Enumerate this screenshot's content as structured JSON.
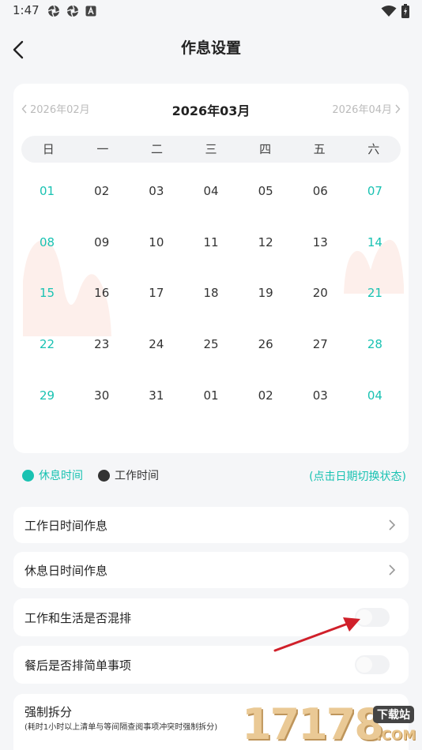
{
  "status_bar": {
    "time": "1:47",
    "icons": [
      "aperture-icon",
      "aperture-icon",
      "a-box-icon",
      "wifi-icon",
      "battery-charging-icon"
    ]
  },
  "header": {
    "back_icon": "chevron-left-icon",
    "title": "作息设置"
  },
  "calendar": {
    "prev_month": "2026年02月",
    "current_month": "2026年03月",
    "next_month": "2026年04月",
    "weekdays": [
      "日",
      "一",
      "二",
      "三",
      "四",
      "五",
      "六"
    ],
    "weeks": [
      [
        "01",
        "02",
        "03",
        "04",
        "05",
        "06",
        "07"
      ],
      [
        "08",
        "09",
        "10",
        "11",
        "12",
        "13",
        "14"
      ],
      [
        "15",
        "16",
        "17",
        "18",
        "19",
        "20",
        "21"
      ],
      [
        "22",
        "23",
        "24",
        "25",
        "26",
        "27",
        "28"
      ],
      [
        "29",
        "30",
        "31",
        "01",
        "02",
        "03",
        "04"
      ]
    ]
  },
  "legend": {
    "rest_label": "休息时间",
    "work_label": "工作时间",
    "hint": "(点击日期切换状态)"
  },
  "settings": {
    "workday_schedule": "工作日时间作息",
    "restday_schedule": "休息日时间作息",
    "mix_work_life": "工作和生活是否混排",
    "after_meal_simple": "餐后是否排简单事项",
    "force_split": "强制拆分",
    "force_split_desc": "(耗时1小时以上清单与等间隔查阅事项冲突时强制拆分)"
  },
  "toggles": {
    "mix_work_life": false,
    "after_meal_simple": false
  },
  "watermark": {
    "number": "17178",
    "badge": "下载站",
    "domain": ".COM"
  },
  "colors": {
    "rest": "#19c2b2",
    "work": "#333333",
    "arrow": "#d0202a",
    "watermark": "#e8c48a"
  }
}
